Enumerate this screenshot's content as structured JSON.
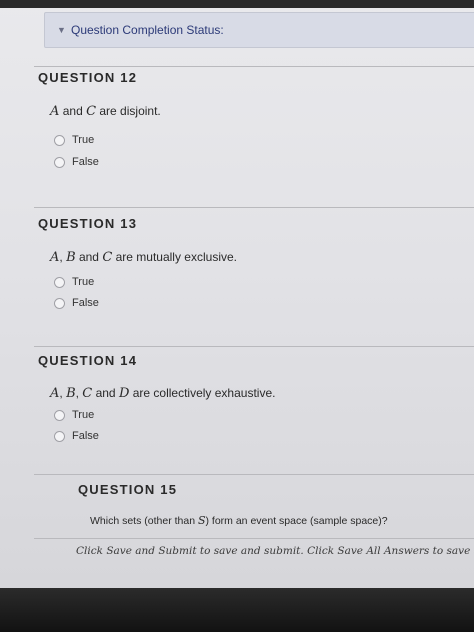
{
  "status_bar": {
    "label": "Question Completion Status:",
    "chevron_icon": "chevron-down-icon"
  },
  "questions": [
    {
      "title": "QUESTION 12",
      "text_parts": [
        "A",
        " and ",
        "C",
        " are disjoint."
      ],
      "options": [
        "True",
        "False"
      ]
    },
    {
      "title": "QUESTION 13",
      "text_parts": [
        "A",
        ", ",
        "B",
        " and ",
        "C",
        " are mutually exclusive."
      ],
      "options": [
        "True",
        "False"
      ]
    },
    {
      "title": "QUESTION 14",
      "text_parts": [
        "A",
        ", ",
        "B",
        ", ",
        "C",
        " and ",
        "D",
        " are collectively exhaustive."
      ],
      "options": [
        "True",
        "False"
      ]
    },
    {
      "title": "QUESTION 15",
      "text_parts": [
        "Which sets (other than ",
        "S",
        ") form an event space (sample space)?"
      ],
      "options": []
    }
  ],
  "footer": {
    "text": "Click Save and Submit to save and submit. Click Save All Answers to save all answers."
  }
}
